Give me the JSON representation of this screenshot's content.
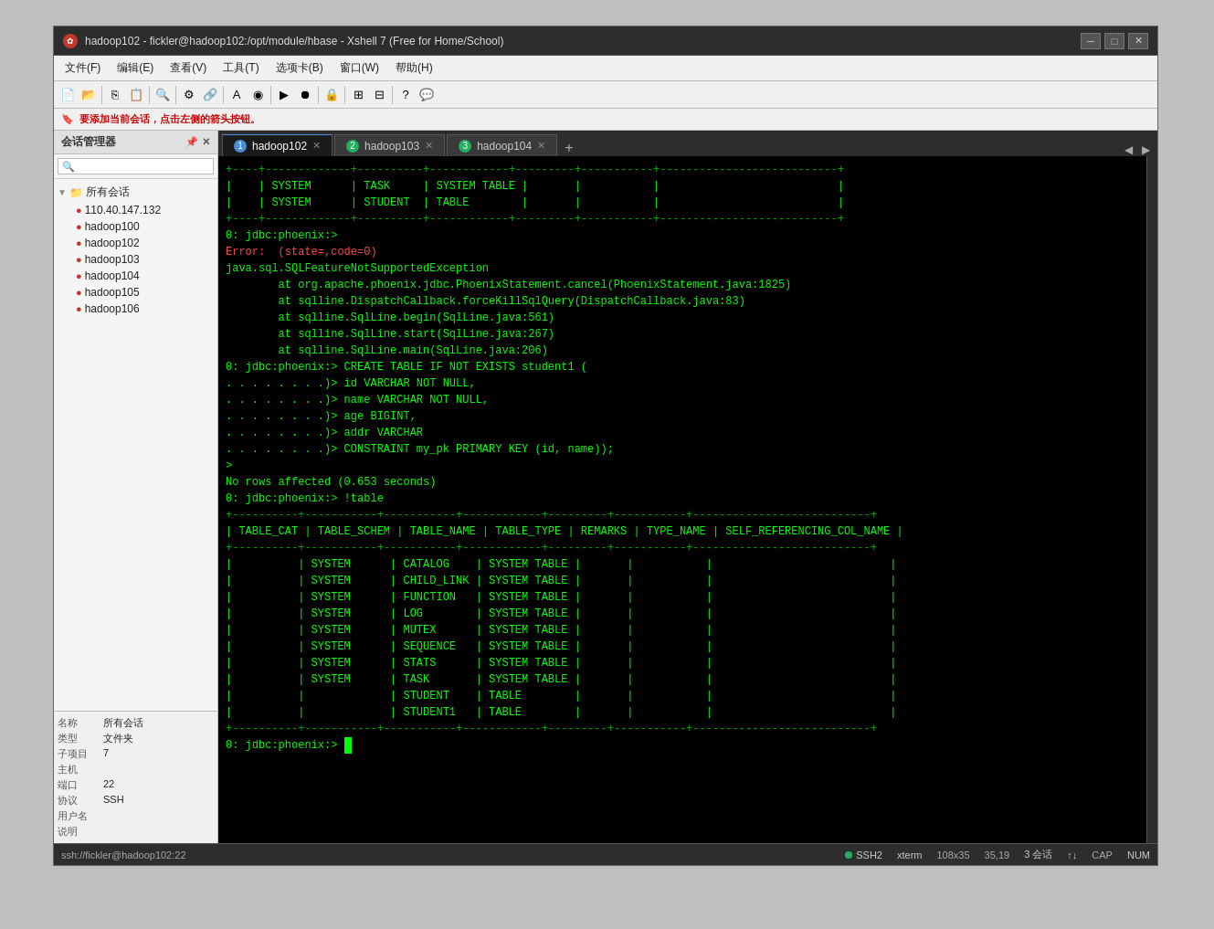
{
  "window": {
    "title": "hadoop102 - fickler@hadoop102:/opt/module/hbase - Xshell 7 (Free for Home/School)",
    "min_label": "─",
    "max_label": "□",
    "close_label": "✕"
  },
  "menubar": {
    "items": [
      "文件(F)",
      "编辑(E)",
      "查看(V)",
      "工具(T)",
      "选项卡(B)",
      "窗口(W)",
      "帮助(H)"
    ]
  },
  "infobar": {
    "text": "要添加当前会话，点击左侧的箭头按钮。"
  },
  "sidebar": {
    "title": "会话管理器",
    "root_label": "所有会话",
    "connections": [
      {
        "label": "110.40.147.132"
      },
      {
        "label": "hadoop100"
      },
      {
        "label": "hadoop102"
      },
      {
        "label": "hadoop103"
      },
      {
        "label": "hadoop104"
      },
      {
        "label": "hadoop105"
      },
      {
        "label": "hadoop106"
      }
    ]
  },
  "session_info": {
    "rows": [
      {
        "label": "名称",
        "value": "所有会话"
      },
      {
        "label": "类型",
        "value": "文件夹"
      },
      {
        "label": "子项目",
        "value": "7"
      },
      {
        "label": "主机",
        "value": ""
      },
      {
        "label": "端口",
        "value": "22"
      },
      {
        "label": "协议",
        "value": "SSH"
      },
      {
        "label": "用户名",
        "value": ""
      },
      {
        "label": "说明",
        "value": ""
      }
    ]
  },
  "tabs": [
    {
      "num": "1",
      "label": "hadoop102",
      "active": true
    },
    {
      "num": "2",
      "label": "hadoop103",
      "active": false
    },
    {
      "num": "3",
      "label": "hadoop104",
      "active": false
    }
  ],
  "terminal": {
    "content_lines": [
      "                   SYSTEM          |  TASK        |  SYSTEM TABLE",
      "                   SYSTEM          |  STUDENT     |  TABLE",
      "",
      "0: jdbc:phoenix:>",
      "Error:  (state=,code=0)",
      "java.sql.SQLFeatureNotSupportedException",
      "        at org.apache.phoenix.jdbc.PhoenixStatement.cancel(PhoenixStatement.java:1825)",
      "        at sqlline.DispatchCallback.forceKillSqlQuery(DispatchCallback.java:83)",
      "        at sqlline.SqlLine.begin(SqlLine.java:561)",
      "        at sqlline.SqlLine.start(SqlLine.java:267)",
      "        at sqlline.SqlLine.main(SqlLine.java:206)",
      "0: jdbc:phoenix:> CREATE TABLE IF NOT EXISTS student1 (",
      ". . . . . . . .)> id VARCHAR NOT NULL,",
      ". . . . . . . .)> name VARCHAR NOT NULL,",
      ". . . . . . . .)> age BIGINT,",
      ". . . . . . . .)> addr VARCHAR",
      ". . . . . . . .)> CONSTRAINT my_pk PRIMARY KEY (id, name));",
      ">",
      "No rows affected (0.653 seconds)",
      "0: jdbc:phoenix:> !table"
    ],
    "table_header": "| TABLE_CAT | TABLE_SCHEM | TABLE_NAME | TABLE_TYPE | REMARKS | TYPE_NAME | SELF_REFERENCING_COL_NAME |",
    "table_rows": [
      {
        "schem": "SYSTEM",
        "name": "CATALOG",
        "type": "SYSTEM TABLE"
      },
      {
        "schem": "SYSTEM",
        "name": "CHILD_LINK",
        "type": "SYSTEM TABLE"
      },
      {
        "schem": "SYSTEM",
        "name": "FUNCTION",
        "type": "SYSTEM TABLE"
      },
      {
        "schem": "SYSTEM",
        "name": "LOG",
        "type": "SYSTEM TABLE"
      },
      {
        "schem": "SYSTEM",
        "name": "MUTEX",
        "type": "SYSTEM TABLE"
      },
      {
        "schem": "SYSTEM",
        "name": "SEQUENCE",
        "type": "SYSTEM TABLE"
      },
      {
        "schem": "SYSTEM",
        "name": "STATS",
        "type": "SYSTEM TABLE"
      },
      {
        "schem": "SYSTEM",
        "name": "TASK",
        "type": "SYSTEM TABLE"
      },
      {
        "schem": "",
        "name": "STUDENT",
        "type": "TABLE"
      },
      {
        "schem": "",
        "name": "STUDENT1",
        "type": "TABLE"
      }
    ],
    "prompt_end": "0: jdbc:phoenix:>"
  },
  "statusbar": {
    "connection": "SSH2",
    "terminal_type": "xterm",
    "size": "108x35",
    "cursor": "35,19",
    "sessions": "3 会话",
    "arrows": "↑↓",
    "cap": "CAP",
    "num": "NUM"
  }
}
